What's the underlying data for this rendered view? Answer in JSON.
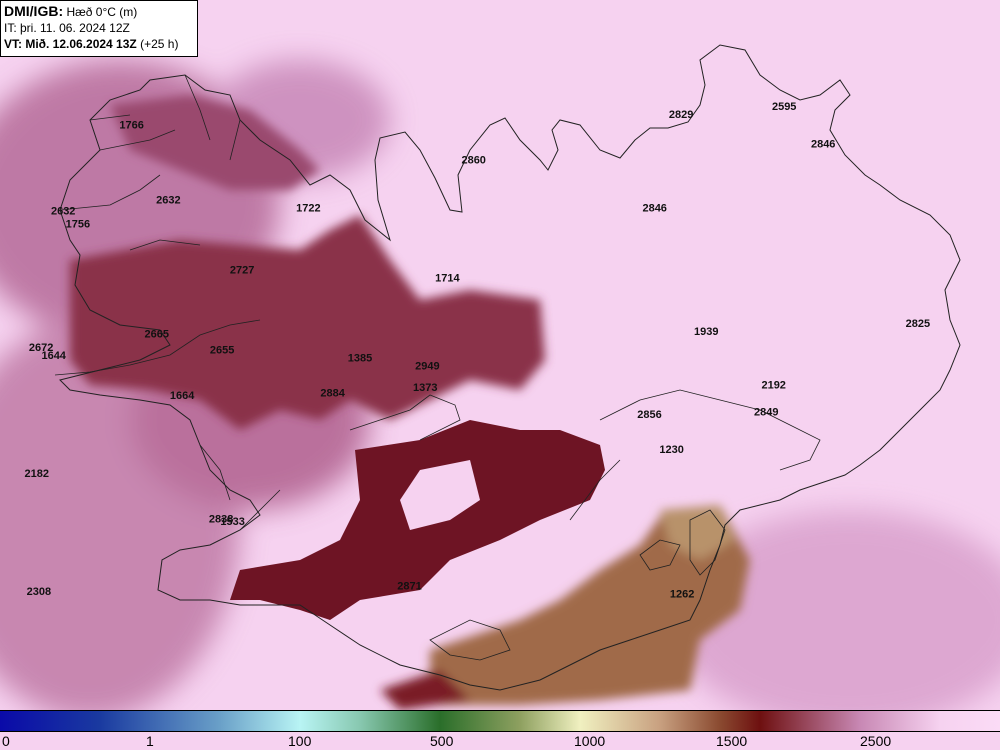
{
  "header": {
    "brand": "DMI/IGB:",
    "field": "Hæð 0°C (m)",
    "init_time": "IT: þri. 11. 06. 2024 12Z",
    "valid_prefix": "VT: Mið. 12.06.2024 13Z",
    "valid_suffix": "(+25 h)"
  },
  "map_points": [
    {
      "label": "1766",
      "lon": -22.55,
      "lat": 66.12
    },
    {
      "label": "2632",
      "lon": -22.2,
      "lat": 65.84
    },
    {
      "label": "2632",
      "lon": -23.2,
      "lat": 65.8
    },
    {
      "label": "1756",
      "lon": -23.06,
      "lat": 65.75
    },
    {
      "label": "1722",
      "lon": -20.87,
      "lat": 65.81
    },
    {
      "label": "2860",
      "lon": -19.3,
      "lat": 65.99
    },
    {
      "label": "2829",
      "lon": -17.33,
      "lat": 66.16
    },
    {
      "label": "2595",
      "lon": -16.35,
      "lat": 66.19
    },
    {
      "label": "2846",
      "lon": -15.98,
      "lat": 66.05
    },
    {
      "label": "2846",
      "lon": -17.58,
      "lat": 65.81
    },
    {
      "label": "2727",
      "lon": -21.5,
      "lat": 65.58
    },
    {
      "label": "1714",
      "lon": -19.55,
      "lat": 65.55
    },
    {
      "label": "1939",
      "lon": -17.09,
      "lat": 65.35
    },
    {
      "label": "2825",
      "lon": -15.08,
      "lat": 65.38
    },
    {
      "label": "2665",
      "lon": -22.31,
      "lat": 65.34
    },
    {
      "label": "2655",
      "lon": -21.69,
      "lat": 65.28
    },
    {
      "label": "2672",
      "lon": -23.41,
      "lat": 65.29
    },
    {
      "label": "1644",
      "lon": -23.29,
      "lat": 65.26
    },
    {
      "label": "1385",
      "lon": -20.38,
      "lat": 65.25
    },
    {
      "label": "2949",
      "lon": -19.74,
      "lat": 65.22
    },
    {
      "label": "1373",
      "lon": -19.76,
      "lat": 65.14
    },
    {
      "label": "2884",
      "lon": -20.64,
      "lat": 65.12
    },
    {
      "label": "1664",
      "lon": -22.07,
      "lat": 65.11
    },
    {
      "label": "2192",
      "lon": -16.45,
      "lat": 65.15
    },
    {
      "label": "2856",
      "lon": -17.63,
      "lat": 65.04
    },
    {
      "label": "2849",
      "lon": -16.52,
      "lat": 65.05
    },
    {
      "label": "1230",
      "lon": -17.42,
      "lat": 64.91
    },
    {
      "label": "2182",
      "lon": -23.45,
      "lat": 64.82
    },
    {
      "label": "2838",
      "lon": -21.7,
      "lat": 64.65
    },
    {
      "label": "1533",
      "lon": -21.59,
      "lat": 64.64
    },
    {
      "label": "2871",
      "lon": -19.91,
      "lat": 64.4
    },
    {
      "label": "1262",
      "lon": -17.32,
      "lat": 64.37
    },
    {
      "label": "2308",
      "lon": -23.43,
      "lat": 64.38
    }
  ],
  "legend": {
    "ticks": [
      {
        "label": "0",
        "value": 0
      },
      {
        "label": "1",
        "value": 1
      },
      {
        "label": "100",
        "value": 100
      },
      {
        "label": "500",
        "value": 500
      },
      {
        "label": "1000",
        "value": 1000
      },
      {
        "label": "1500",
        "value": 1500
      },
      {
        "label": "2500",
        "value": 2500
      }
    ],
    "colors": {
      "low": "#0a0aa8",
      "mid_cyan": "#b8f4f4",
      "mid_green": "#2a6e2a",
      "mid_tan": "#f0f0c0",
      "brown": "#8a4a30",
      "dark_red": "#6e1010",
      "high_pink": "#f6d2f0"
    }
  },
  "colors": {
    "background": "#f6d2f0",
    "dark_maroon": "#7a1e28",
    "mauve": "#9a4a6e",
    "tan_brown": "#a06a4a",
    "coastline": "#222222"
  }
}
